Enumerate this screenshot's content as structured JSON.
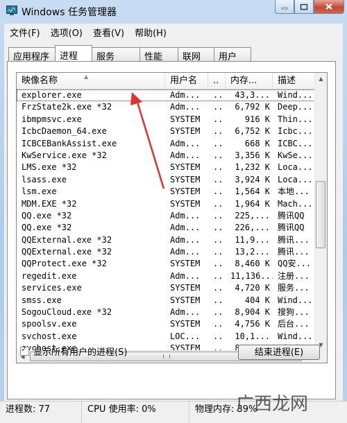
{
  "window": {
    "title": "Windows 任务管理器"
  },
  "menu": [
    "文件(F)",
    "选项(O)",
    "查看(V)",
    "帮助(H)"
  ],
  "tabs": [
    "应用程序",
    "进程",
    "服务",
    "性能",
    "联网",
    "用户"
  ],
  "active_tab": "进程",
  "columns": {
    "name": "映像名称",
    "user": "用户名",
    "session": "..",
    "memory": "内存...",
    "desc": "描述"
  },
  "processes": [
    {
      "name": "explorer.exe",
      "user": "Adm...",
      "ses": "..",
      "mem": "43,3...",
      "desc": "Wind..."
    },
    {
      "name": "FrzState2k.exe *32",
      "user": "Adm...",
      "ses": "..",
      "mem": "6,792 K",
      "desc": "Deep..."
    },
    {
      "name": "ibmpmsvc.exe",
      "user": "SYSTEM",
      "ses": "..",
      "mem": "916 K",
      "desc": "Thin..."
    },
    {
      "name": "IcbcDaemon_64.exe",
      "user": "SYSTEM",
      "ses": "..",
      "mem": "6,752 K",
      "desc": "Icbc..."
    },
    {
      "name": "ICBCEBankAssist.exe",
      "user": "Adm...",
      "ses": "..",
      "mem": "668 K",
      "desc": "ICBC..."
    },
    {
      "name": "KwService.exe *32",
      "user": "Adm...",
      "ses": "..",
      "mem": "3,356 K",
      "desc": "KwSe..."
    },
    {
      "name": "LMS.exe *32",
      "user": "SYSTEM",
      "ses": "..",
      "mem": "1,232 K",
      "desc": "Loca..."
    },
    {
      "name": "lsass.exe",
      "user": "SYSTEM",
      "ses": "..",
      "mem": "3,924 K",
      "desc": "Loca..."
    },
    {
      "name": "lsm.exe",
      "user": "SYSTEM",
      "ses": "..",
      "mem": "1,564 K",
      "desc": "本地..."
    },
    {
      "name": "MDM.EXE *32",
      "user": "SYSTEM",
      "ses": "..",
      "mem": "1,964 K",
      "desc": "Mach..."
    },
    {
      "name": "QQ.exe *32",
      "user": "Adm...",
      "ses": "..",
      "mem": "225,...",
      "desc": "腾讯QQ"
    },
    {
      "name": "QQ.exe *32",
      "user": "Adm...",
      "ses": "..",
      "mem": "226,...",
      "desc": "腾讯QQ"
    },
    {
      "name": "QQExternal.exe *32",
      "user": "Adm...",
      "ses": "..",
      "mem": "11,9...",
      "desc": "腾讯..."
    },
    {
      "name": "QQExternal.exe *32",
      "user": "Adm...",
      "ses": "..",
      "mem": "13,2...",
      "desc": "腾讯..."
    },
    {
      "name": "QQProtect.exe *32",
      "user": "SYSTEM",
      "ses": "..",
      "mem": "8,460 K",
      "desc": "QQ安..."
    },
    {
      "name": "regedit.exe",
      "user": "Adm...",
      "ses": "..",
      "mem": "11,136...",
      "desc": "注册..."
    },
    {
      "name": "services.exe",
      "user": "SYSTEM",
      "ses": "..",
      "mem": "4,720 K",
      "desc": "服务..."
    },
    {
      "name": "smss.exe",
      "user": "SYSTEM",
      "ses": "..",
      "mem": "404 K",
      "desc": "Wind..."
    },
    {
      "name": "SogouCloud.exe *32",
      "user": "Adm...",
      "ses": "..",
      "mem": "8,904 K",
      "desc": "搜狗..."
    },
    {
      "name": "spoolsv.exe",
      "user": "SYSTEM",
      "ses": "..",
      "mem": "4,756 K",
      "desc": "后台..."
    },
    {
      "name": "svchost.exe",
      "user": "LOC...",
      "ses": "..",
      "mem": "10,1...",
      "desc": "Wind..."
    },
    {
      "name": "svchost.exe",
      "user": "SYSTEM",
      "ses": "..",
      "mem": "8,276 K",
      "desc": "Wind..."
    }
  ],
  "show_all_users": "显示所有用户的进程(S)",
  "end_process": "结束进程(E)",
  "status": {
    "processes": "进程数: 77",
    "cpu": "CPU 使用率: 0%",
    "memory": "物理内存: 39%"
  },
  "watermark": "广西龙网"
}
